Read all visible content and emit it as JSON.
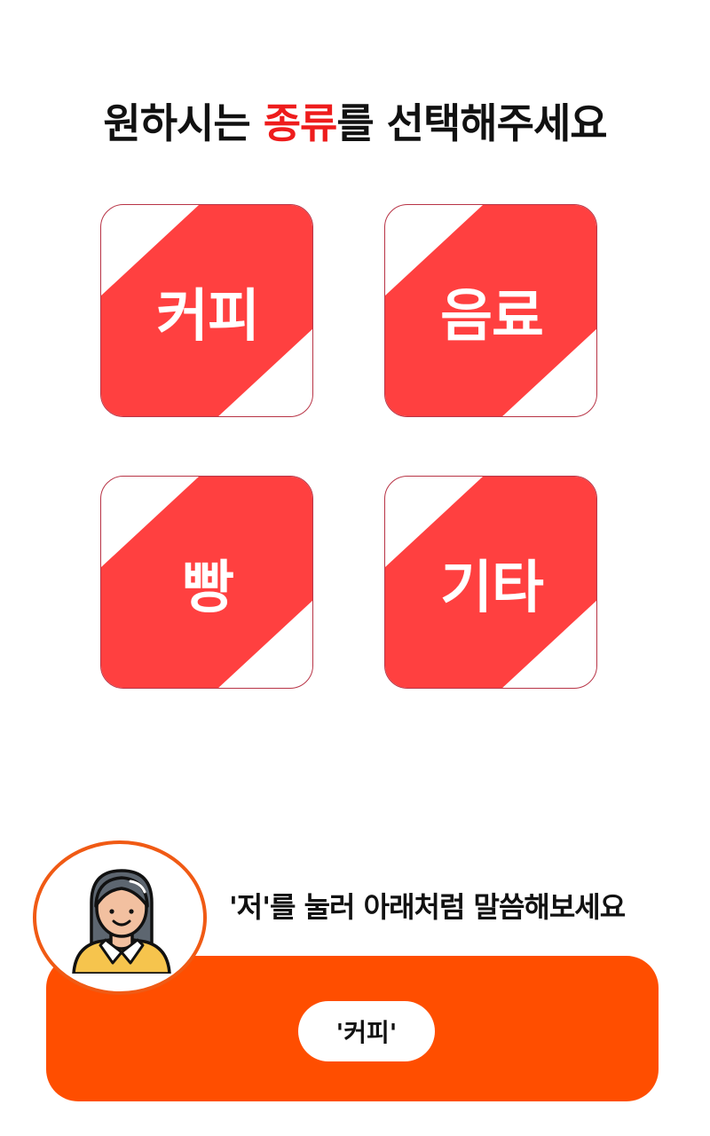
{
  "header": {
    "title_prefix": "원하시는 ",
    "title_accent": "종류",
    "title_suffix": "를 선택해주세요"
  },
  "categories": [
    {
      "label": "커피"
    },
    {
      "label": "음료"
    },
    {
      "label": "빵"
    },
    {
      "label": "기타"
    }
  ],
  "voice": {
    "instruction": "'저'를 눌러 아래처럼 말씀해보세요",
    "example": "'커피'"
  },
  "colors": {
    "tile_fill": "#ff4040",
    "title_accent": "#ee1c1c",
    "voice_panel": "#ff4e00",
    "avatar_border": "#f05a14"
  },
  "icons": {
    "avatar": "woman-assistant-icon"
  }
}
